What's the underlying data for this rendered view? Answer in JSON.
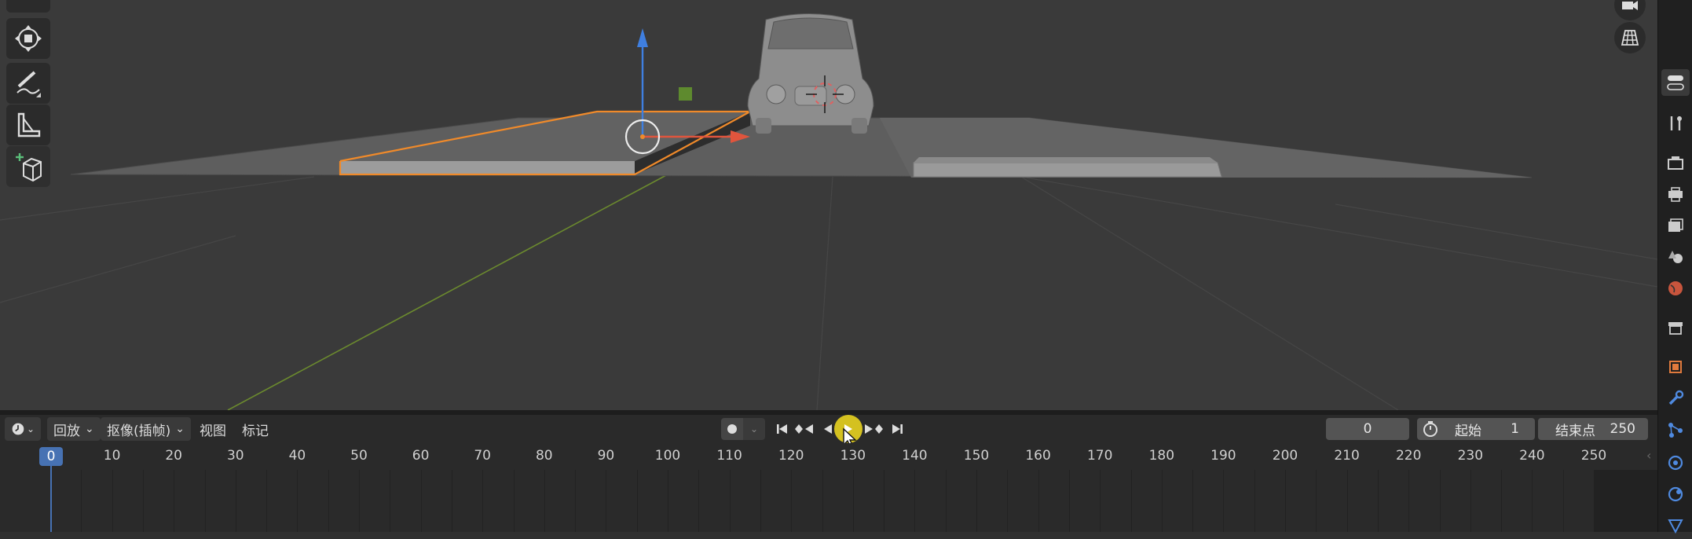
{
  "timeline": {
    "editor_type_icon": "clock-icon",
    "playback_label": "回放",
    "keying_label": "抠像(插帧)",
    "view_label": "视图",
    "marker_label": "标记",
    "current_frame": "0",
    "start_label": "起始",
    "start_value": "1",
    "end_label": "结束点",
    "end_value": "250",
    "playhead_frame": "0",
    "ruler_ticks": [
      "10",
      "20",
      "30",
      "40",
      "50",
      "60",
      "70",
      "80",
      "90",
      "100",
      "110",
      "120",
      "130",
      "140",
      "150",
      "160",
      "170",
      "180",
      "190",
      "200",
      "210",
      "220",
      "230",
      "240",
      "250"
    ]
  },
  "toolbar": {
    "tools": [
      "transform-tool",
      "annotate-tool",
      "measure-tool",
      "add-cube-tool"
    ]
  },
  "colors": {
    "selection_outline": "#f08a2a",
    "x_axis": "#e0553d",
    "z_axis": "#3f7fe0",
    "y_axis_line": "#6b8a2e",
    "playhead": "#4772b3",
    "play_highlight": "#e7d11f"
  }
}
